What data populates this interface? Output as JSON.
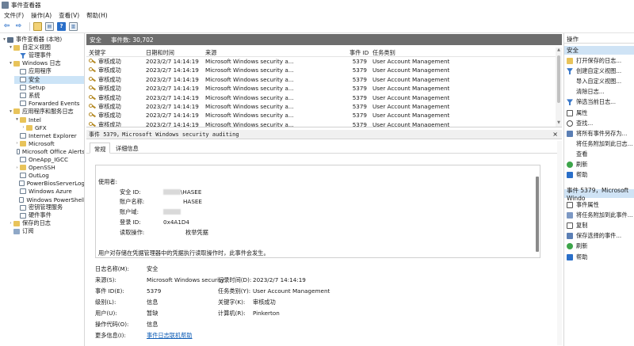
{
  "window": {
    "title": "事件查看器"
  },
  "menu": [
    "文件(F)",
    "操作(A)",
    "查看(V)",
    "帮助(H)"
  ],
  "toolbar": [
    "back-icon",
    "forward-icon",
    "folder-icon",
    "console-icon",
    "help-icon",
    "panel-icon"
  ],
  "tree": [
    {
      "label": "事件查看器 (本地)",
      "icon": "computer-icon",
      "level": 0,
      "expand": "▾"
    },
    {
      "label": "自定义视图",
      "icon": "folder-icon",
      "level": 1,
      "expand": "▾"
    },
    {
      "label": "管理事件",
      "icon": "filter-icon",
      "level": 2,
      "expand": ""
    },
    {
      "label": "Windows 日志",
      "icon": "folder-icon",
      "level": 1,
      "expand": "▾"
    },
    {
      "label": "应用程序",
      "icon": "log-icon",
      "level": 2,
      "expand": ""
    },
    {
      "label": "安全",
      "icon": "log-icon",
      "level": 2,
      "expand": "",
      "selected": true
    },
    {
      "label": "Setup",
      "icon": "log-icon",
      "level": 2,
      "expand": ""
    },
    {
      "label": "系统",
      "icon": "log-icon",
      "level": 2,
      "expand": ""
    },
    {
      "label": "Forwarded Events",
      "icon": "log-icon",
      "level": 2,
      "expand": ""
    },
    {
      "label": "应用程序和服务日志",
      "icon": "folder-icon",
      "level": 1,
      "expand": "▾"
    },
    {
      "label": "Intel",
      "icon": "folder-icon",
      "level": 2,
      "expand": "▾"
    },
    {
      "label": "GFX",
      "icon": "folder-icon",
      "level": 3,
      "expand": "›"
    },
    {
      "label": "Internet Explorer",
      "icon": "log-icon",
      "level": 2,
      "expand": ""
    },
    {
      "label": "Microsoft",
      "icon": "folder-icon",
      "level": 2,
      "expand": "›"
    },
    {
      "label": "Microsoft Office Alerts",
      "icon": "log-icon",
      "level": 2,
      "expand": ""
    },
    {
      "label": "OneApp_IGCC",
      "icon": "log-icon",
      "level": 2,
      "expand": ""
    },
    {
      "label": "OpenSSH",
      "icon": "folder-icon",
      "level": 2,
      "expand": "›"
    },
    {
      "label": "OutLog",
      "icon": "log-icon",
      "level": 2,
      "expand": ""
    },
    {
      "label": "PowerBiosServerLog",
      "icon": "log-icon",
      "level": 2,
      "expand": ""
    },
    {
      "label": "Windows Azure",
      "icon": "log-icon",
      "level": 2,
      "expand": ""
    },
    {
      "label": "Windows PowerShell",
      "icon": "log-icon",
      "level": 2,
      "expand": ""
    },
    {
      "label": "密钥管理服务",
      "icon": "log-icon",
      "level": 2,
      "expand": ""
    },
    {
      "label": "硬件事件",
      "icon": "log-icon",
      "level": 2,
      "expand": ""
    },
    {
      "label": "保存的日志",
      "icon": "folder-icon",
      "level": 1,
      "expand": "›"
    },
    {
      "label": "订阅",
      "icon": "subscription-icon",
      "level": 1,
      "expand": ""
    }
  ],
  "log_header": {
    "name": "安全",
    "count": "事件数: 30,702"
  },
  "columns": [
    "关键字",
    "日期和时间",
    "来源",
    "事件 ID",
    "任务类别"
  ],
  "rows": [
    [
      "审核成功",
      "2023/2/7 14:14:19",
      "Microsoft Windows security a...",
      "5379",
      "User Account Management"
    ],
    [
      "审核成功",
      "2023/2/7 14:14:19",
      "Microsoft Windows security a...",
      "5379",
      "User Account Management"
    ],
    [
      "审核成功",
      "2023/2/7 14:14:19",
      "Microsoft Windows security a...",
      "5379",
      "User Account Management"
    ],
    [
      "审核成功",
      "2023/2/7 14:14:19",
      "Microsoft Windows security a...",
      "5379",
      "User Account Management"
    ],
    [
      "审核成功",
      "2023/2/7 14:14:19",
      "Microsoft Windows security a...",
      "5379",
      "User Account Management"
    ],
    [
      "审核成功",
      "2023/2/7 14:14:19",
      "Microsoft Windows security a...",
      "5379",
      "User Account Management"
    ],
    [
      "审核成功",
      "2023/2/7 14:14:19",
      "Microsoft Windows security a...",
      "5379",
      "User Account Management"
    ],
    [
      "审核成功",
      "2023/2/7 14:14:19",
      "Microsoft Windows security a...",
      "5379",
      "User Account Management"
    ]
  ],
  "detail": {
    "header": "事件 5379，Microsoft Windows security auditing",
    "close": "×",
    "tabs": [
      "常规",
      "详细信息"
    ],
    "message": {
      "subject_label": "使用者:",
      "lines": [
        {
          "label": "安全 ID:",
          "value": "\\HASEE",
          "redact": true
        },
        {
          "label": "账户名称:",
          "value": "HASEE",
          "redact": false
        },
        {
          "label": "账户域:",
          "value": "",
          "redact": true
        },
        {
          "label": "登录 ID:",
          "value": "0x4A1D4",
          "redact": false
        },
        {
          "label": "读取操作:",
          "value": "枚举凭据",
          "redact": false
        }
      ],
      "footer": "用户对存储在凭据管理器中的凭据执行读取操作时，此事件会发生。"
    },
    "fields": {
      "log_name_label": "日志名称(M):",
      "log_name": "安全",
      "source_label": "来源(S):",
      "source": "Microsoft Windows security",
      "logged_label": "记录时间(D):",
      "logged": "2023/2/7 14:14:19",
      "event_id_label": "事件 ID(E):",
      "event_id": "5379",
      "task_label": "任务类别(Y):",
      "task": "User Account Management",
      "level_label": "级别(L):",
      "level": "信息",
      "keywords_label": "关键字(K):",
      "keywords": "审核成功",
      "user_label": "用户(U):",
      "user": "暂缺",
      "computer_label": "计算机(R):",
      "computer": "Pinkerton",
      "opcode_label": "操作代码(O):",
      "opcode": "信息",
      "more_label": "更多信息(I):",
      "more_link": "事件日志联机帮助"
    }
  },
  "actions": {
    "header": "操作",
    "section1": "安全",
    "items1": [
      {
        "label": "打开保存的日志...",
        "icon": "open-icon"
      },
      {
        "label": "创建自定义视图...",
        "icon": "filter-icon"
      },
      {
        "label": "导入自定义视图...",
        "icon": "none"
      },
      {
        "label": "清除日志...",
        "icon": "none"
      },
      {
        "label": "筛选当前日志...",
        "icon": "filter-icon"
      },
      {
        "label": "属性",
        "icon": "props-icon"
      },
      {
        "label": "查找...",
        "icon": "find-icon"
      },
      {
        "label": "将所有事件另存为...",
        "icon": "save-icon"
      },
      {
        "label": "将任务附加到此日志...",
        "icon": "none"
      },
      {
        "label": "查看",
        "icon": "view-icon"
      },
      {
        "label": "刷新",
        "icon": "refresh-icon"
      },
      {
        "label": "帮助",
        "icon": "help-icon"
      }
    ],
    "section2": "事件 5379，Microsoft Windo",
    "items2": [
      {
        "label": "事件属性",
        "icon": "props-icon"
      },
      {
        "label": "将任务附加到此事件...",
        "icon": "attach-icon"
      },
      {
        "label": "复制",
        "icon": "copy-icon"
      },
      {
        "label": "保存选择的事件...",
        "icon": "save-icon"
      },
      {
        "label": "刷新",
        "icon": "refresh-icon"
      },
      {
        "label": "帮助",
        "icon": "help-icon"
      }
    ]
  }
}
